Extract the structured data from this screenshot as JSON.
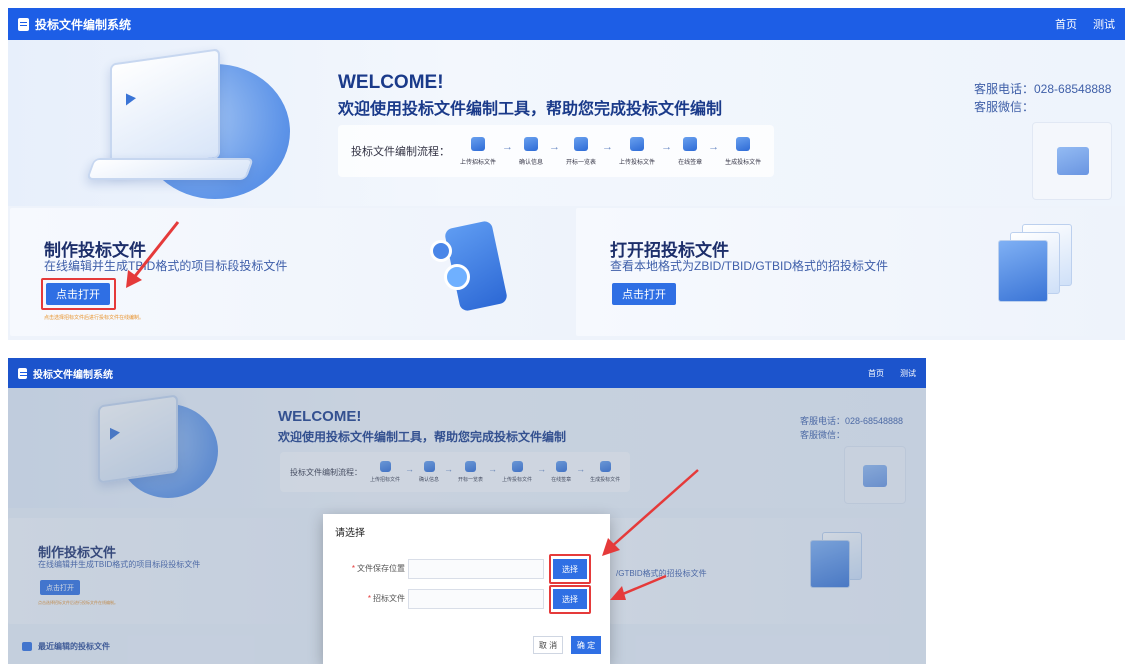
{
  "app": {
    "title": "投标文件编制系统"
  },
  "nav": {
    "home": "首页",
    "user": "测试"
  },
  "hero": {
    "welcome": "WELCOME!",
    "subtitle": "欢迎使用投标文件编制工具，帮助您完成投标文件编制",
    "flow_label": "投标文件编制流程：",
    "steps": [
      "上传招标文件",
      "确认信息",
      "开标一览表",
      "上传投标文件",
      "在线签章",
      "生成投标文件"
    ],
    "service_phone": "客服电话：028-68548888",
    "service_wechat": "客服微信："
  },
  "cards": {
    "make": {
      "title": "制作投标文件",
      "desc": "在线编辑并生成TBID格式的项目标段投标文件",
      "button": "点击打开",
      "hint": "点击选择招标文件后进行投标文件在线编制。"
    },
    "open": {
      "title": "打开招投标文件",
      "desc": "查看本地格式为ZBID/TBID/GTBID格式的招投标文件",
      "button": "点击打开"
    }
  },
  "shot2": {
    "desc_partial": "/GTBID格式的招投标文件",
    "recent": "最近编辑的投标文件"
  },
  "dialog": {
    "title": "请选择",
    "save_location_label": "文件保存位置",
    "tender_file_label": "招标文件",
    "required_mark": "*",
    "select_button": "选择",
    "cancel": "取 消",
    "confirm": "确 定"
  },
  "colors": {
    "primary": "#1d5ee6",
    "button": "#2f6fe4",
    "highlight": "#e53a3a",
    "hint": "#e8922b"
  }
}
